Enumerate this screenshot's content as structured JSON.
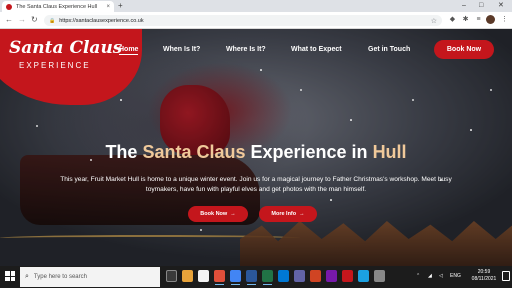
{
  "browser": {
    "tab_title": "The Santa Claus Experience Hull",
    "tab_close": "×",
    "new_tab": "+",
    "url": "https://santaclausexperience.co.uk",
    "controls": {
      "minimize": "–",
      "maximize": "□",
      "close": "✕"
    }
  },
  "site": {
    "logo_script": "Santa Claus",
    "logo_sub": "EXPERIENCE",
    "nav": [
      {
        "label": "Home"
      },
      {
        "label": "When Is It?"
      },
      {
        "label": "Where Is It?"
      },
      {
        "label": "What to Expect"
      },
      {
        "label": "Get in Touch"
      }
    ],
    "book_label": "Book Now",
    "headline_prefix": "The ",
    "headline_accent1": "Santa Claus",
    "headline_middle": " Experience in ",
    "headline_accent2": "Hull",
    "lead": "This year, Fruit Market Hull is home to a unique winter event. Join us for a magical journey to Father Christmas's workshop. Meet busy toymakers, have fun with playful elves and get photos with the man himself.",
    "cta_book": "Book Now",
    "cta_more": "More Info",
    "arrow": "→",
    "accent_color": "#c4161c",
    "headline_accent_color": "#f0c99a"
  },
  "taskbar": {
    "search_placeholder": "Type here to search",
    "tray_text": "ENG",
    "time": "20:59",
    "date": "08/11/2021"
  }
}
